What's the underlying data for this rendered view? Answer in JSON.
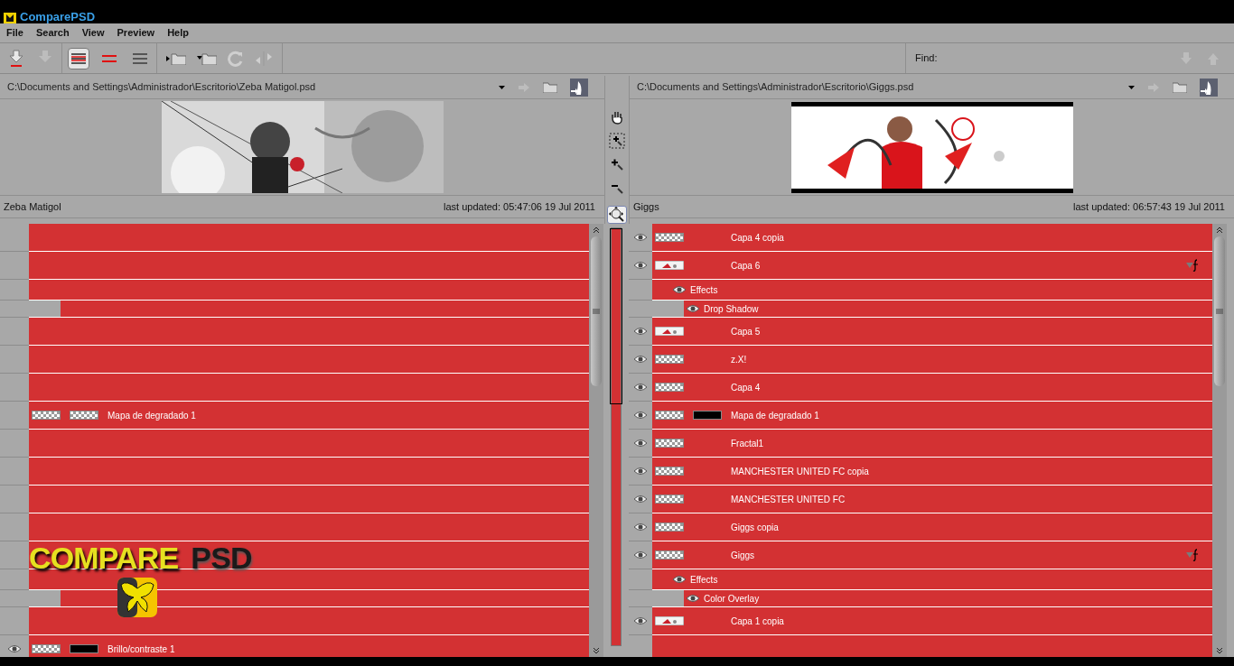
{
  "window": {
    "title": "ComparePSD"
  },
  "menu": [
    {
      "label": "File"
    },
    {
      "label": "Search"
    },
    {
      "label": "View"
    },
    {
      "label": "Preview"
    },
    {
      "label": "Help"
    }
  ],
  "toolbar": {
    "view_modes": [
      {
        "selected": true
      },
      {
        "selected": false
      },
      {
        "selected": false
      }
    ],
    "find_label": "Find:"
  },
  "tools": [
    {
      "kind": "hand",
      "selected": false
    },
    {
      "kind": "zoom-rect",
      "selected": false
    },
    {
      "kind": "zoom-in",
      "selected": false
    },
    {
      "kind": "zoom-out",
      "selected": false
    },
    {
      "kind": "zoom-fit",
      "selected": true
    }
  ],
  "left": {
    "path": "C:\\Documents and Settings\\Administrador\\Escritorio\\Zeba Matigol.psd",
    "name": "Zeba Matigol",
    "updated": "last updated: 05:47:06 19 Jul 2011",
    "rows": [
      {
        "kind": "layer"
      },
      {
        "kind": "layer"
      },
      {
        "kind": "effects"
      },
      {
        "kind": "effect"
      },
      {
        "kind": "layer"
      },
      {
        "kind": "layer"
      },
      {
        "kind": "layer"
      },
      {
        "kind": "layer",
        "name": "Mapa de degradado 1",
        "thumbs": [
          {
            "kind": "checker"
          },
          {
            "kind": "checker"
          }
        ]
      },
      {
        "kind": "layer"
      },
      {
        "kind": "layer"
      },
      {
        "kind": "layer"
      },
      {
        "kind": "layer"
      },
      {
        "kind": "layer"
      },
      {
        "kind": "effects"
      },
      {
        "kind": "effect"
      },
      {
        "kind": "layer"
      },
      {
        "kind": "layer",
        "name": "Brillo/contraste 1",
        "eye": true,
        "thumbs": [
          {
            "kind": "checker"
          },
          {
            "kind": "black"
          }
        ]
      }
    ]
  },
  "right": {
    "path": "C:\\Documents and Settings\\Administrador\\Escritorio\\Giggs.psd",
    "name": "Giggs",
    "updated": "last updated: 06:57:43 19 Jul 2011",
    "rows": [
      {
        "kind": "layer",
        "name": "Capa 4 copia",
        "eye": true,
        "thumbs": [
          {
            "kind": "checker"
          }
        ]
      },
      {
        "kind": "layer",
        "name": "Capa 6",
        "eye": true,
        "fx": true
      },
      {
        "kind": "effects",
        "name": "Effects",
        "eye": true
      },
      {
        "kind": "effect",
        "name": "Drop Shadow",
        "eye": true
      },
      {
        "kind": "layer",
        "name": "Capa 5",
        "eye": true
      },
      {
        "kind": "layer",
        "name": "z.X!",
        "eye": true,
        "thumbs": [
          {
            "kind": "checker"
          }
        ]
      },
      {
        "kind": "layer",
        "name": "Capa 4",
        "eye": true,
        "thumbs": [
          {
            "kind": "checker"
          }
        ]
      },
      {
        "kind": "layer",
        "name": "Mapa de degradado 1",
        "eye": true,
        "thumbs": [
          {
            "kind": "checker"
          },
          {
            "kind": "black"
          }
        ]
      },
      {
        "kind": "layer",
        "name": "Fractal1",
        "eye": true,
        "thumbs": [
          {
            "kind": "checker"
          }
        ]
      },
      {
        "kind": "layer",
        "name": "MANCHESTER UNITED FC copia",
        "eye": true,
        "thumbs": [
          {
            "kind": "checker"
          }
        ]
      },
      {
        "kind": "layer",
        "name": "MANCHESTER UNITED FC",
        "eye": true,
        "thumbs": [
          {
            "kind": "checker"
          }
        ]
      },
      {
        "kind": "layer",
        "name": "Giggs copia",
        "eye": true,
        "thumbs": [
          {
            "kind": "checker"
          }
        ]
      },
      {
        "kind": "layer",
        "name": "Giggs",
        "eye": true,
        "thumbs": [
          {
            "kind": "checker"
          }
        ],
        "fx": true
      },
      {
        "kind": "effects",
        "name": "Effects",
        "eye": true
      },
      {
        "kind": "effect",
        "name": "Color Overlay",
        "eye": true
      },
      {
        "kind": "layer",
        "name": "Capa 1 copia",
        "eye": true
      },
      {
        "kind": "layer"
      }
    ]
  },
  "logo": {
    "word1": "COMPARE",
    "word2": "PSD"
  }
}
